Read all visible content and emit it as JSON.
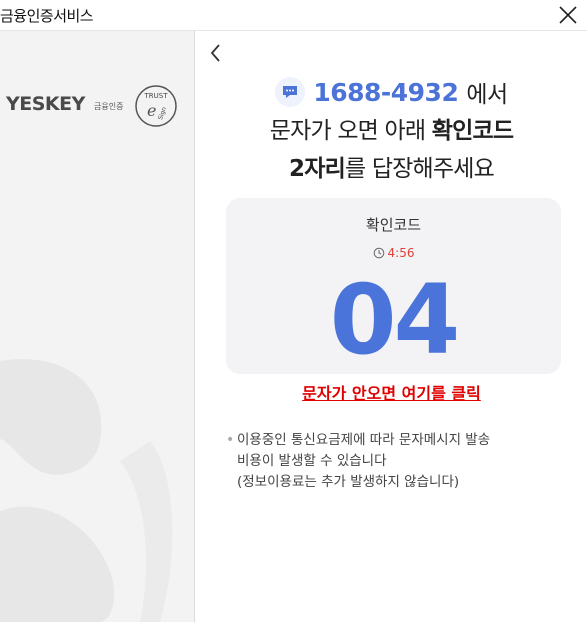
{
  "window": {
    "title": "금융인증서비스"
  },
  "brand": {
    "name": "YESKEY",
    "sub": "금융인증",
    "seal_text": "TRUST e Sign"
  },
  "headline": {
    "phone": "1688-4932",
    "phone_suffix": "에서",
    "line2_prefix": "문자가 오면 아래 ",
    "line2_bold": "확인코드",
    "line3_bold": "2자리",
    "line3_suffix": "를 답장해주세요"
  },
  "code_card": {
    "title": "확인코드",
    "timer": "4:56",
    "code": "04"
  },
  "resend_link": "문자가 안오면 여기를 클릭",
  "notice": {
    "bullet": "•",
    "lines": [
      "이용중인 통신요금제에 따라 문자메시지 발송",
      "비용이 발생할 수 있습니다",
      "(정보이용료는 추가 발생하지 않습니다)"
    ]
  },
  "colors": {
    "accent": "#4b74db",
    "timer": "#e0403a",
    "link": "#e00000",
    "card_bg": "#f3f3f5"
  },
  "icons": {
    "close": "close-icon",
    "back": "chevron-left-icon",
    "message": "chat-bubble-icon",
    "timer": "clock-icon"
  }
}
